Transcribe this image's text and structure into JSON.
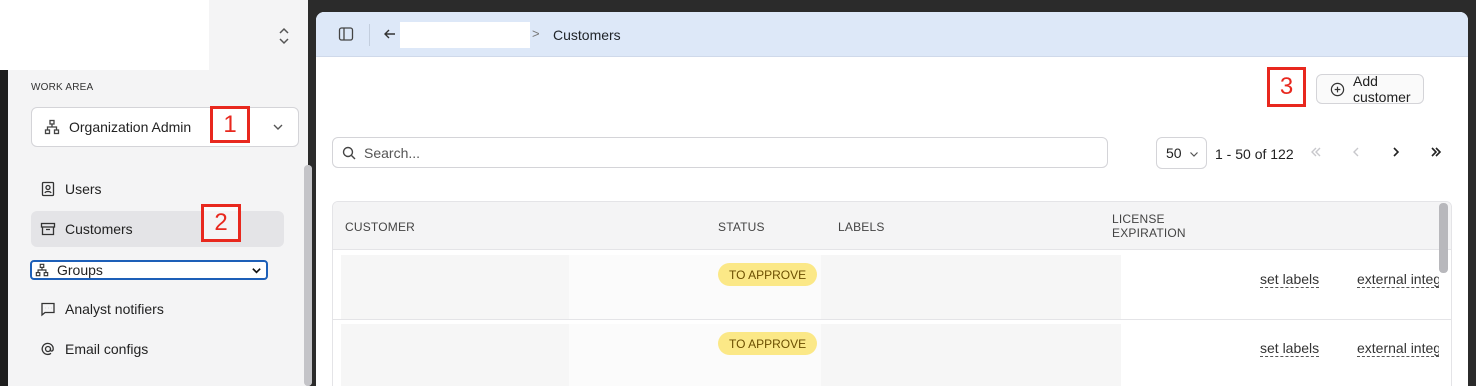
{
  "sidebar": {
    "work_area_label": "WORK AREA",
    "org_select_value": "Organization Admin",
    "items": [
      {
        "label": "Users",
        "icon": "user-card-icon"
      },
      {
        "label": "Customers",
        "icon": "archive-box-icon",
        "active": true
      },
      {
        "label": "Groups",
        "icon": "hierarchy-icon"
      },
      {
        "label": "Analyst notifiers",
        "icon": "message-square-icon"
      },
      {
        "label": "Email configs",
        "icon": "at-sign-icon"
      }
    ]
  },
  "markers": {
    "m1": "1",
    "m2": "2",
    "m3": "3"
  },
  "topbar": {
    "separator": ">",
    "current_crumb": "Customers"
  },
  "toolbar": {
    "add_customer_label": "Add customer"
  },
  "search": {
    "placeholder": "Search..."
  },
  "pagination": {
    "page_size": "50",
    "range_text": "1 - 50 of 122"
  },
  "table": {
    "columns": [
      "CUSTOMER",
      "STATUS",
      "LABELS",
      "LICENSE\nEXPIRATION"
    ],
    "rows": [
      {
        "status": "TO APPROVE",
        "action1": "set labels",
        "action2": "external integ"
      },
      {
        "status": "TO APPROVE",
        "action1": "set labels",
        "action2": "external integ"
      }
    ]
  },
  "colors": {
    "accent_topbar": "#dde8f8",
    "badge_yellow": "#fbe887",
    "marker_red": "#e8281e",
    "focus_blue": "#1d5fb8"
  }
}
